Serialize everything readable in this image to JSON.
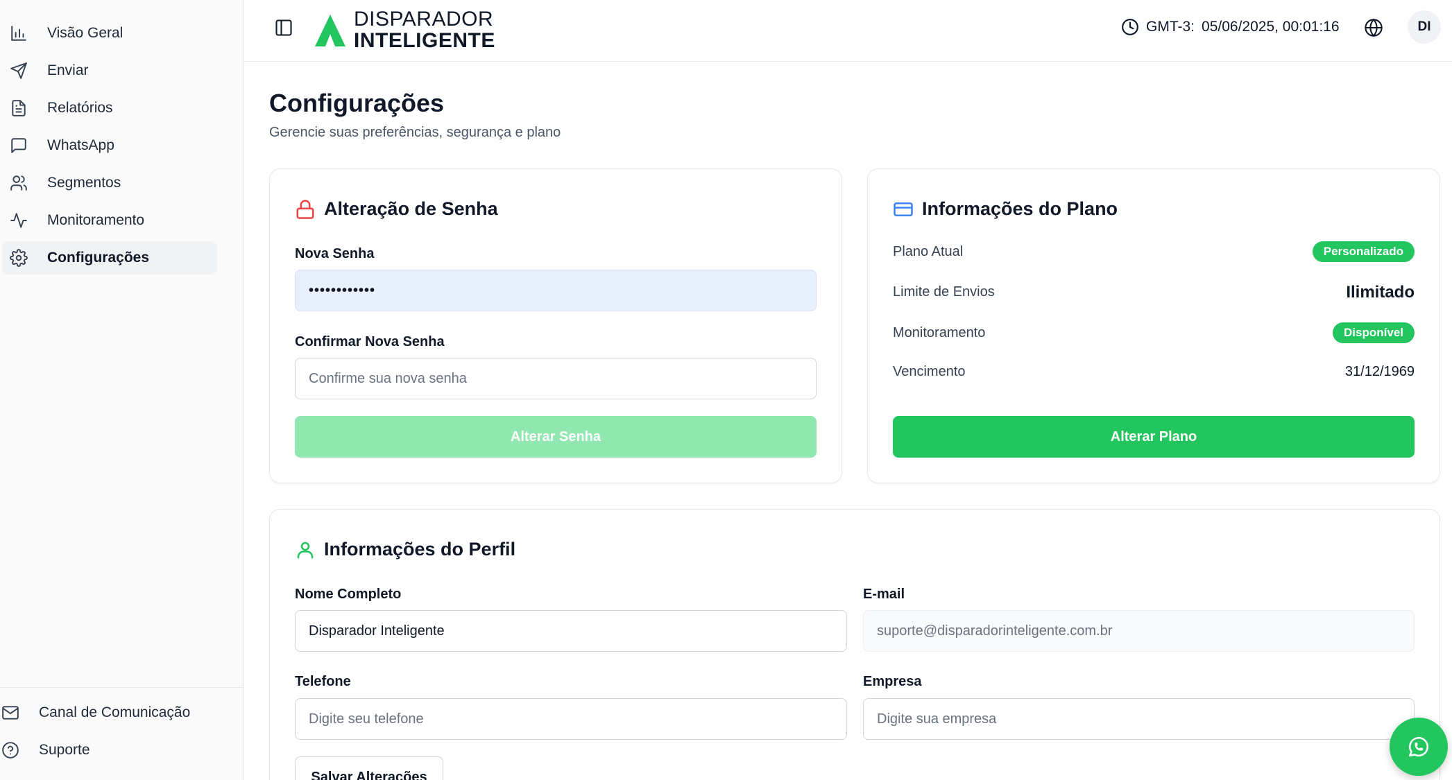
{
  "sidebar": {
    "items": [
      {
        "label": "Visão Geral",
        "icon": "bar-chart-icon"
      },
      {
        "label": "Enviar",
        "icon": "send-icon"
      },
      {
        "label": "Relatórios",
        "icon": "file-text-icon"
      },
      {
        "label": "WhatsApp",
        "icon": "message-square-icon"
      },
      {
        "label": "Segmentos",
        "icon": "users-icon"
      },
      {
        "label": "Monitoramento",
        "icon": "activity-icon"
      },
      {
        "label": "Configurações",
        "icon": "gear-icon",
        "active": true
      }
    ],
    "footer": [
      {
        "label": "Canal de Comunicação",
        "icon": "mail-icon"
      },
      {
        "label": "Suporte",
        "icon": "help-circle-icon"
      }
    ]
  },
  "header": {
    "logo_line1": "DISPARADOR",
    "logo_line2": "INTELIGENTE",
    "timezone": "GMT-3:",
    "datetime": "05/06/2025, 00:01:16",
    "avatar_initials": "DI"
  },
  "page": {
    "title": "Configurações",
    "subtitle": "Gerencie suas preferências, segurança e plano"
  },
  "password_card": {
    "title": "Alteração de Senha",
    "new_password_label": "Nova Senha",
    "new_password_value": "••••••••••••",
    "confirm_label": "Confirmar Nova Senha",
    "confirm_placeholder": "Confirme sua nova senha",
    "submit_label": "Alterar Senha"
  },
  "plan_card": {
    "title": "Informações do Plano",
    "rows": {
      "current_plan_label": "Plano Atual",
      "current_plan_value": "Personalizado",
      "limit_label": "Limite de Envios",
      "limit_value": "Ilimitado",
      "monitoring_label": "Monitoramento",
      "monitoring_value": "Disponível",
      "expiry_label": "Vencimento",
      "expiry_value": "31/12/1969"
    },
    "submit_label": "Alterar Plano"
  },
  "profile_card": {
    "title": "Informações do Perfil",
    "name_label": "Nome Completo",
    "name_value": "Disparador Inteligente",
    "email_label": "E-mail",
    "email_value": "suporte@disparadorinteligente.com.br",
    "phone_label": "Telefone",
    "phone_placeholder": "Digite seu telefone",
    "company_label": "Empresa",
    "company_placeholder": "Digite sua empresa",
    "save_label": "Salvar Alterações"
  },
  "colors": {
    "accent": "#22c55e",
    "accent_disabled": "#90e8b0",
    "lock_icon": "#ef4444",
    "card_icon": "#3b82f6",
    "user_icon": "#22c55e"
  }
}
